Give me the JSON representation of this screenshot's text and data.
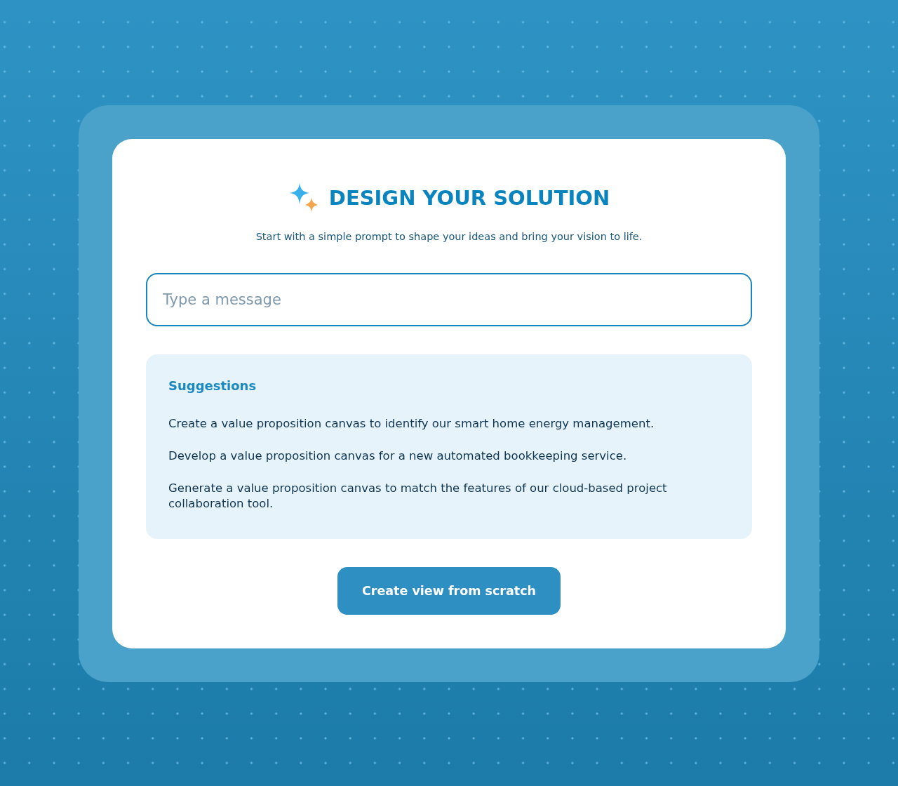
{
  "header": {
    "title": "DESIGN YOUR SOLUTION",
    "subtitle": "Start with a simple prompt to shape your ideas and bring your vision to life."
  },
  "message_field": {
    "placeholder": "Type a message"
  },
  "suggestions": {
    "heading": "Suggestions",
    "items": [
      "Create a value proposition canvas to identify our smart home energy management.",
      "Develop a value proposition canvas for a new automated bookkeeping service.",
      "Generate a value proposition canvas to match the features of our cloud-based project collaboration tool."
    ]
  },
  "button": {
    "label": "Create view from scratch"
  }
}
